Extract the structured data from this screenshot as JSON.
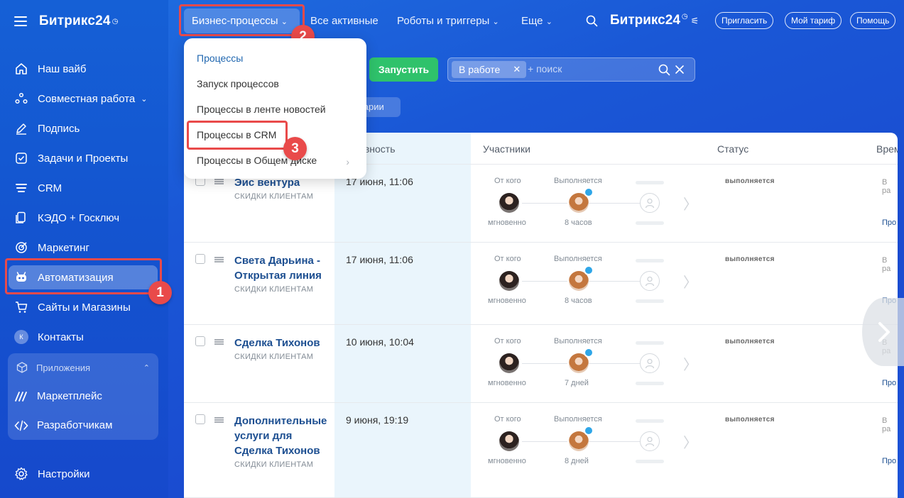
{
  "sidebar": {
    "brand": "Битрикс24",
    "items": [
      {
        "label": "Наш вайб",
        "icon": "home-icon"
      },
      {
        "label": "Совместная работа",
        "icon": "collab-icon",
        "chevron": "⌄"
      },
      {
        "label": "Подпись",
        "icon": "sign-icon"
      },
      {
        "label": "Задачи и Проекты",
        "icon": "tasks-icon"
      },
      {
        "label": "CRM",
        "icon": "crm-icon"
      },
      {
        "label": "КЭДО + Госключ",
        "icon": "kedo-icon"
      },
      {
        "label": "Маркетинг",
        "icon": "marketing-icon"
      },
      {
        "label": "Автоматизация",
        "icon": "robot-icon"
      },
      {
        "label": "Сайты и Магазины",
        "icon": "cart-icon"
      },
      {
        "label": "Контакты",
        "icon": "contacts-icon",
        "avatar_letter": "К"
      }
    ],
    "apps": {
      "title": "Приложения",
      "items": [
        {
          "label": "Маркетплейс",
          "icon": "marketplace-icon"
        },
        {
          "label": "Разработчикам",
          "icon": "code-icon"
        }
      ]
    },
    "settings": "Настройки"
  },
  "topbar": {
    "active_tab": "Бизнес-процессы",
    "tabs": [
      "Все активные",
      "Роботы и триггеры",
      "Еще"
    ],
    "brand": "Битрикс24",
    "buttons": [
      "Пригласить",
      "Мой тариф",
      "Помощь"
    ]
  },
  "toolbar": {
    "start_button": "Запустить",
    "filter_chip": "В работе",
    "search_placeholder": "+ поиск",
    "comments_tag": "тарии"
  },
  "menu": {
    "items": [
      "Процессы",
      "Запуск процессов",
      "Процессы в ленте новостей",
      "Процессы в CRM",
      "Процессы в Общем диске"
    ]
  },
  "table": {
    "headers": {
      "activity": "ивность",
      "participants": "Участники",
      "status": "Статус",
      "time": "Врем"
    },
    "from_label": "От кого",
    "running_label": "Выполняется",
    "instant_label": "мгновенно",
    "time_label": "В ра",
    "time_link": "Про",
    "rows": [
      {
        "title": "Эис вентура",
        "sub": "СКИДКИ КЛИЕНТАМ",
        "date": "17 июня, 11:06",
        "duration": "8 часов",
        "status": "выполняется"
      },
      {
        "title": "Света Дарьина - Открытая линия",
        "sub": "СКИДКИ КЛИЕНТАМ",
        "date": "17 июня, 11:06",
        "duration": "8 часов",
        "status": "выполняется"
      },
      {
        "title": "Сделка Тихонов",
        "sub": "СКИДКИ КЛИЕНТАМ",
        "date": "10 июня, 10:04",
        "duration": "7 дней",
        "status": "выполняется"
      },
      {
        "title": "Дополнительные услуги для Сделка Тихонов",
        "sub": "СКИДКИ КЛИЕНТАМ",
        "date": "9 июня, 19:19",
        "duration": "8 дней",
        "status": "выполняется"
      }
    ]
  },
  "badges": [
    "1",
    "2",
    "3"
  ],
  "colors": {
    "accent_red": "#e94a4a",
    "start_green": "#2fc26b",
    "link_blue": "#1d4f91"
  }
}
